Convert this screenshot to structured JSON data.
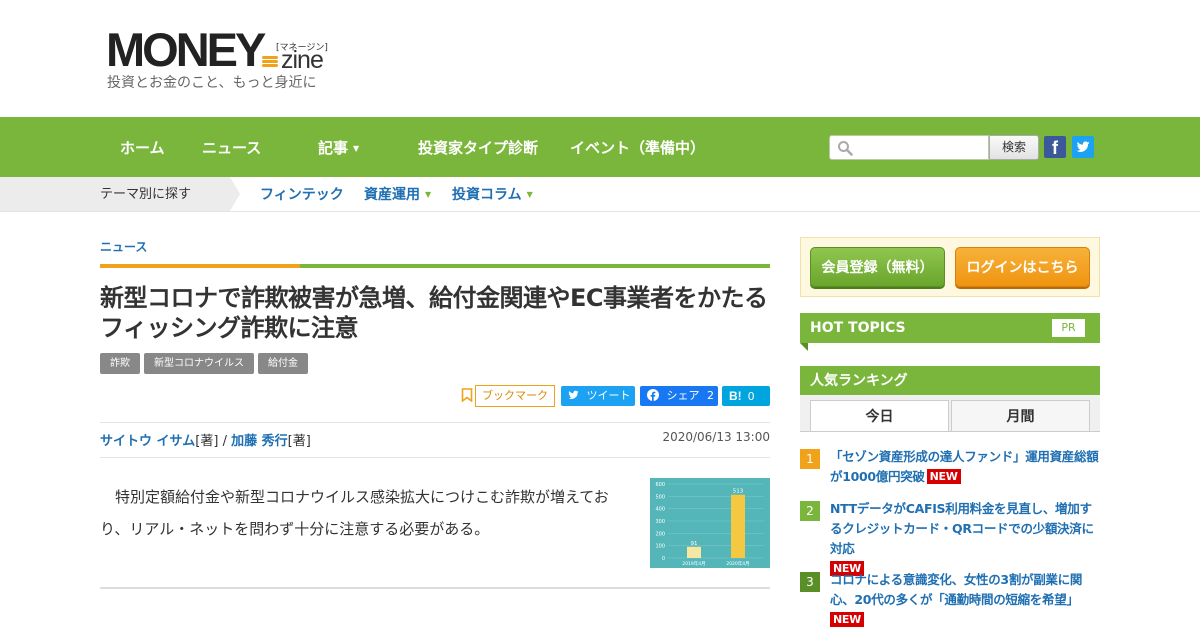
{
  "header": {
    "logo_main": "MONEY",
    "logo_kana": "[マネージン]",
    "logo_zine": "zine",
    "tagline": "投資とお金のこと、もっと身近に"
  },
  "nav": {
    "items": [
      "ホーム",
      "ニュース",
      "記事",
      "投資家タイプ診断",
      "イベント（準備中）"
    ],
    "search_button": "検索",
    "search_placeholder": ""
  },
  "theme": {
    "label": "テーマ別に探す",
    "links": [
      "フィンテック",
      "資産運用",
      "投資コラム"
    ]
  },
  "article": {
    "category": "ニュース",
    "title": "新型コロナで詐欺被害が急増、給付金関連やEC事業者をかたるフィッシング詐欺に注意",
    "tags": [
      "詐欺",
      "新型コロナウイルス",
      "給付金"
    ],
    "share": {
      "bookmark": "ブックマーク",
      "tweet": "ツイート",
      "facebook": "シェア",
      "facebook_count": "2",
      "hatena_count": "0"
    },
    "author1": "サイトウ イサム",
    "author1_role": "[著]",
    "separator": " / ",
    "author2": "加藤 秀行",
    "author2_role": "[著]",
    "date": "2020/06/13 13:00",
    "lead": "特別定額給付金や新型コロナウイルス感染拡大につけこむ詐欺が増えており、リアル・ネットを問わず十分に注意する必要がある。",
    "thumb_chart": {
      "type": "bar",
      "categories": [
        "2019年4月",
        "2020年4月"
      ],
      "values": [
        91,
        513
      ],
      "ylim": [
        0,
        600
      ],
      "yticks": [
        "600",
        "500",
        "400",
        "300",
        "200",
        "100",
        "0"
      ]
    }
  },
  "sidebar": {
    "register": "会員登録（無料）",
    "login": "ログインはこちら",
    "hot_topics": "HOT TOPICS",
    "pr": "PR",
    "ranking": "人気ランキング",
    "tab_today": "今日",
    "tab_month": "月間",
    "new_label": "NEW",
    "items": [
      {
        "num": "1",
        "text": "「セゾン資産形成の達人ファンド」運用資産総額が1000億円突破",
        "color": "#f0a21a"
      },
      {
        "num": "2",
        "text": "NTTデータがCAFIS利用料金を見直し、増加するクレジットカード・QRコードでの少額決済に対応",
        "color": "#7ab63b"
      },
      {
        "num": "3",
        "text": "コロナによる意識変化、女性の3割が副業に関心、20代の多くが「通勤時間の短縮を希望」",
        "color": "#5a8f27"
      }
    ]
  },
  "colors": {
    "green": "#7ab63b",
    "orange": "#f0a21a",
    "link_blue": "#1f6fb2",
    "new_red": "#d60000"
  }
}
